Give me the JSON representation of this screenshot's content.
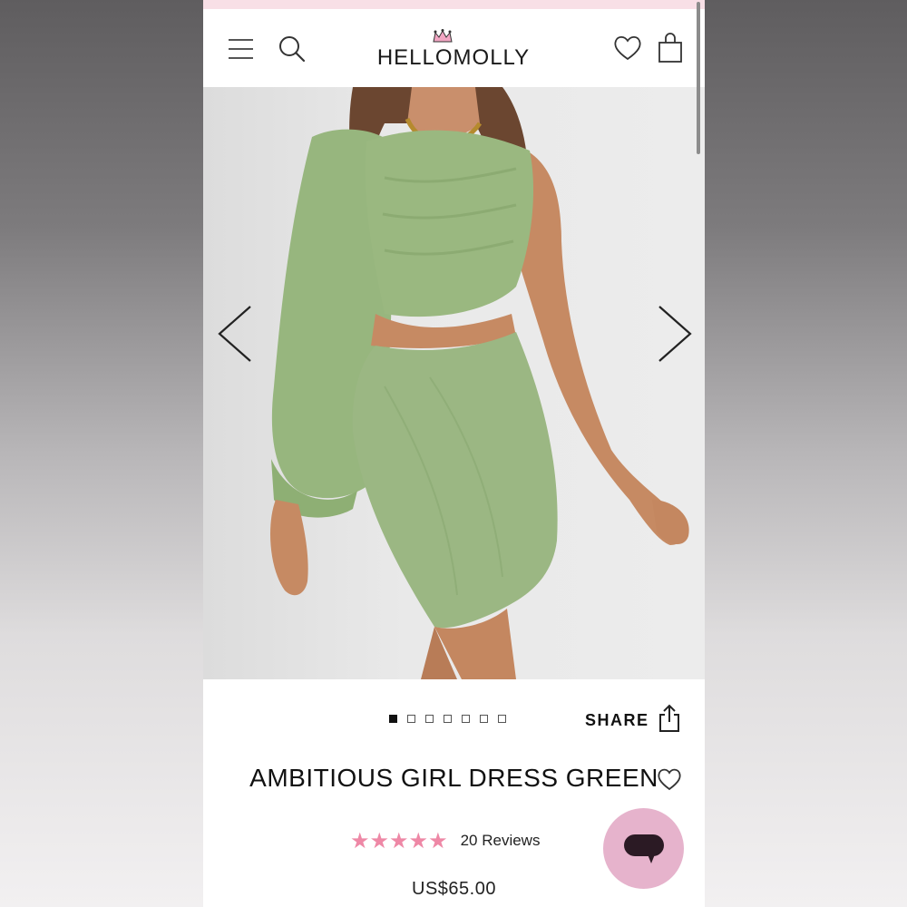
{
  "brand": {
    "logo_text": "HELLOMOLLY"
  },
  "header": {
    "menu_icon": "hamburger-icon",
    "search_icon": "search-icon",
    "wishlist_icon": "heart-icon",
    "cart_icon": "shopping-bag-icon"
  },
  "gallery": {
    "image_description_icon": "product-photo",
    "total_images": 7,
    "active_index": 1,
    "prev_icon": "chevron-left-icon",
    "next_icon": "chevron-right-icon"
  },
  "share": {
    "label": "SHARE",
    "icon": "share-icon"
  },
  "product": {
    "title": "AMBITIOUS GIRL DRESS GREEN",
    "rating": 5,
    "stars": "★★★★★",
    "reviews_label": "20 Reviews",
    "price": "US$65.00"
  },
  "colors": {
    "promo_bar": "#f8dfe6",
    "star_pink": "#ee88a6",
    "chat_bubble": "#e6b3cc",
    "dress_green": "#9bb783"
  },
  "chat": {
    "icon": "chat-bubble-icon"
  }
}
